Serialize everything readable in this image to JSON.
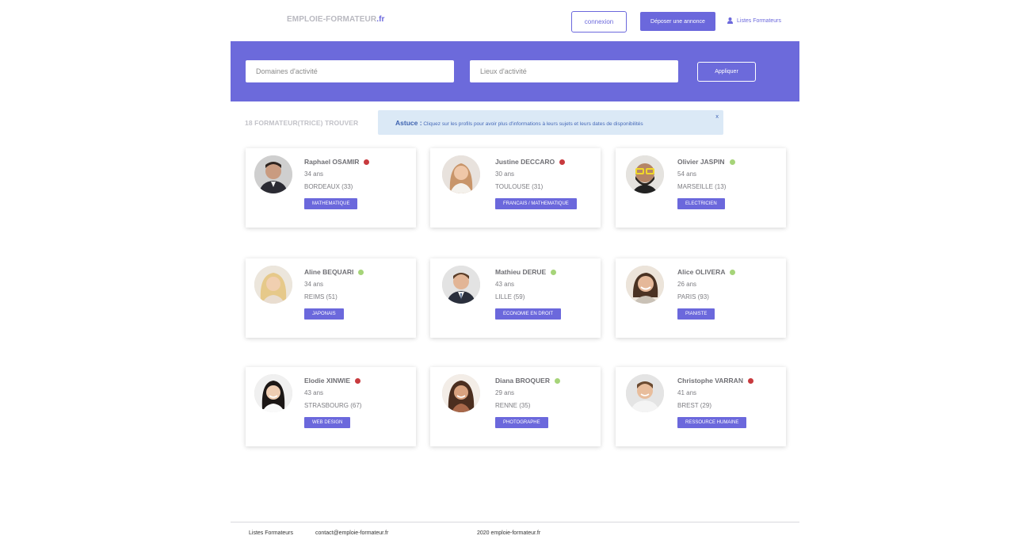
{
  "header": {
    "logo_main": "EMPLOIE-FORMATEUR",
    "logo_tld": ".fr",
    "login_label": "connexion",
    "post_label": "Déposer une annonce",
    "trainers_label": "Listes Formateurs",
    "trainers_icon": "user-icon",
    "accent_color": "#6b68dc"
  },
  "search": {
    "domains_placeholder": "Domaines d'activité",
    "places_placeholder": "Lieux d'activité",
    "apply_label": "Appliquer"
  },
  "results": {
    "count_label": "18 FORMATEUR(TRICE) TROUVER"
  },
  "tip": {
    "label": "Astuce :",
    "text": "Cliquez sur les profils pour avoir plus d'informations à leurs sujets et leurs dates de disponibilités",
    "close": "x"
  },
  "status_colors": {
    "busy": "#c83a3e",
    "free": "#a6d479"
  },
  "trainers": [
    {
      "name": "Raphael OSAMIR",
      "age": "34 ans",
      "city": "BORDEAUX (33)",
      "tag": "MATHEMATIQUE",
      "status": "busy"
    },
    {
      "name": "Justine DECCARO",
      "age": "30 ans",
      "city": "TOULOUSE (31)",
      "tag": "FRANCAIS / MATHEMATIQUE",
      "status": "busy"
    },
    {
      "name": "Olivier JASPIN",
      "age": "54 ans",
      "city": "MARSEILLE (13)",
      "tag": "ELECTRICIEN",
      "status": "free"
    },
    {
      "name": "Aline BEQUARI",
      "age": "34 ans",
      "city": "REIMS (51)",
      "tag": "JAPONAIS",
      "status": "free"
    },
    {
      "name": "Mathieu DERUE",
      "age": "43 ans",
      "city": "LILLE (59)",
      "tag": "ECONOMIE EN DROIT",
      "status": "free"
    },
    {
      "name": "Alice OLIVERA",
      "age": "26 ans",
      "city": "PARIS (93)",
      "tag": "PIANISTE",
      "status": "free"
    },
    {
      "name": "Elodie XINWIE",
      "age": "43 ans",
      "city": "STRASBOURG (67)",
      "tag": "WEB DESIGN",
      "status": "busy"
    },
    {
      "name": "Diana BROQUER",
      "age": "29 ans",
      "city": "RENNE (35)",
      "tag": "PHOTOGRAPHE",
      "status": "free"
    },
    {
      "name": "Christophe VARRAN",
      "age": "41 ans",
      "city": "BREST (29)",
      "tag": "RESSOURCE HUMAINE",
      "status": "busy"
    }
  ],
  "footer": {
    "link_trainers": "Listes Formateurs",
    "email": "contact@emploie-formateur.fr",
    "copyright": "2020 emploie-formateur.fr"
  }
}
